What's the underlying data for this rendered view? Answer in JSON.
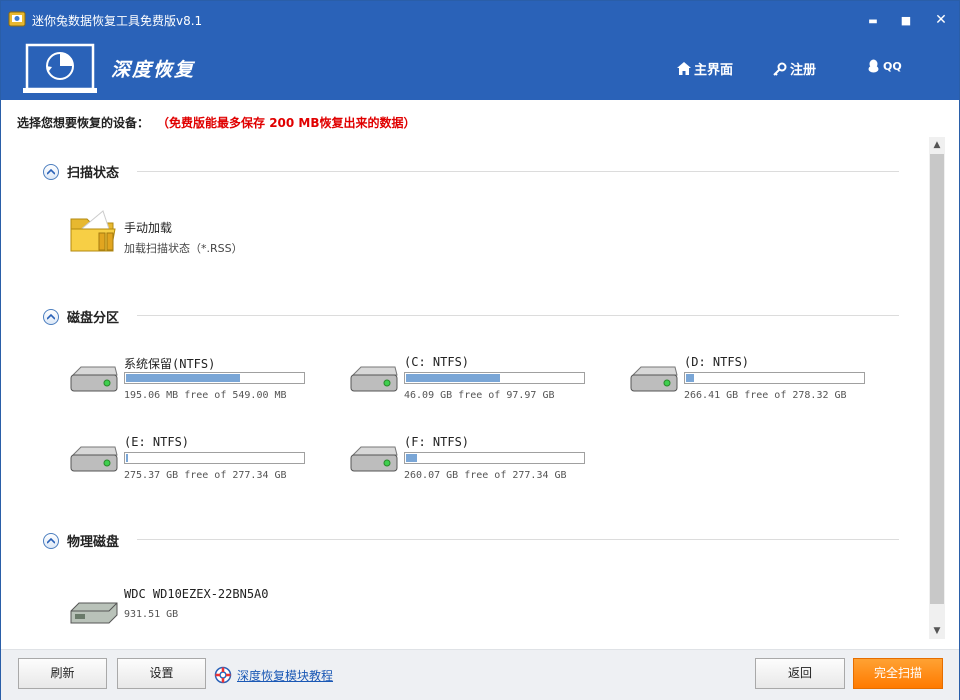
{
  "window": {
    "title": "迷你兔数据恢复工具免费版v8.1",
    "min_label": "▬",
    "max_label": "■",
    "close_label": "✕"
  },
  "header": {
    "brand": "深度恢复",
    "nav": {
      "home": "主界面",
      "register": "注册",
      "qq": "QQ"
    }
  },
  "prompt": {
    "text": "选择您想要恢复的设备：",
    "note": "（免费版能最多保存 200 MB恢复出来的数据）"
  },
  "sections": {
    "scan_status": {
      "title": "扫描状态",
      "item_title": "手动加载",
      "item_sub": "加载扫描状态（*.RSS）"
    },
    "partitions": {
      "title": "磁盘分区",
      "drives": [
        {
          "name": "系统保留(NTFS)",
          "free": "195.06 MB free of 549.00 MB",
          "used_fraction": 0.645
        },
        {
          "name": "(C: NTFS)",
          "free": "46.09 GB free of 97.97 GB",
          "used_fraction": 0.53
        },
        {
          "name": "(D: NTFS)",
          "free": "266.41 GB free of 278.32 GB",
          "used_fraction": 0.043
        },
        {
          "name": "(E: NTFS)",
          "free": "275.37 GB free of 277.34 GB",
          "used_fraction": 0.007
        },
        {
          "name": "(F: NTFS)",
          "free": "260.07 GB free of 277.34 GB",
          "used_fraction": 0.062
        }
      ]
    },
    "physical": {
      "title": "物理磁盘",
      "disk_name": "WDC WD10EZEX-22BN5A0",
      "disk_size": "931.51 GB"
    }
  },
  "footer": {
    "refresh": "刷新",
    "settings": "设置",
    "tutorial": "深度恢复模块教程",
    "back": "返回",
    "full_scan": "完全扫描"
  },
  "colors": {
    "accent": "#2a62b8",
    "warning": "#e00000",
    "primary_button": "#ff8a1a",
    "usage_bar": "#7aa6d6"
  }
}
